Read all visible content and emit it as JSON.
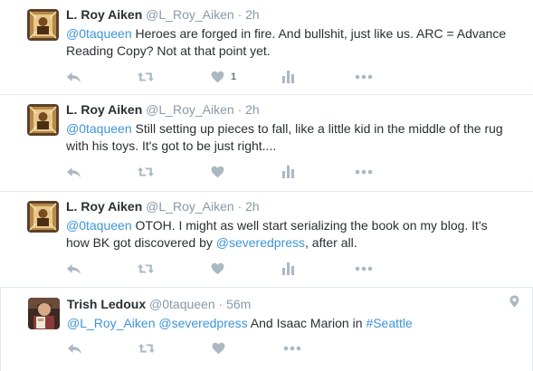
{
  "colors": {
    "link": "#3b94d9",
    "text": "#292f33",
    "muted": "#8899a6",
    "icon": "#aab8c2",
    "border": "#e1e8ed"
  },
  "tweets": [
    {
      "name": "L. Roy Aiken",
      "handle": "@L_Roy_Aiken",
      "separator": "·",
      "time": "2h",
      "segments": [
        {
          "text": "@0taqueen",
          "link": true
        },
        {
          "text": " Heroes are forged in fire. And bullshit, just like us. ARC = Advance Reading Copy? Not at that point yet.",
          "link": false
        }
      ],
      "like_count": "1"
    },
    {
      "name": "L. Roy Aiken",
      "handle": "@L_Roy_Aiken",
      "separator": "·",
      "time": "2h",
      "segments": [
        {
          "text": "@0taqueen",
          "link": true
        },
        {
          "text": " Still setting up pieces to fall, like a little kid in the middle of the rug with his toys. It's got to be just right....",
          "link": false
        }
      ],
      "like_count": ""
    },
    {
      "name": "L. Roy Aiken",
      "handle": "@L_Roy_Aiken",
      "separator": "·",
      "time": "2h",
      "segments": [
        {
          "text": "@0taqueen",
          "link": true
        },
        {
          "text": " OTOH. I might as well start serializing the book on my blog. It's how BK got discovered by ",
          "link": false
        },
        {
          "text": "@severedpress",
          "link": true
        },
        {
          "text": ", after all.",
          "link": false
        }
      ],
      "like_count": ""
    },
    {
      "name": "Trish Ledoux",
      "handle": "@0taqueen",
      "separator": "·",
      "time": "56m",
      "segments": [
        {
          "text": "@L_Roy_Aiken",
          "link": true
        },
        {
          "text": " ",
          "link": false
        },
        {
          "text": "@severedpress",
          "link": true
        },
        {
          "text": " And Isaac Marion in ",
          "link": false
        },
        {
          "text": "#Seattle",
          "link": true
        }
      ],
      "like_count": ""
    }
  ],
  "icons": [
    "reply-icon",
    "retweet-icon",
    "like-icon",
    "analytics-icon",
    "more-icon",
    "location-pin-icon"
  ]
}
